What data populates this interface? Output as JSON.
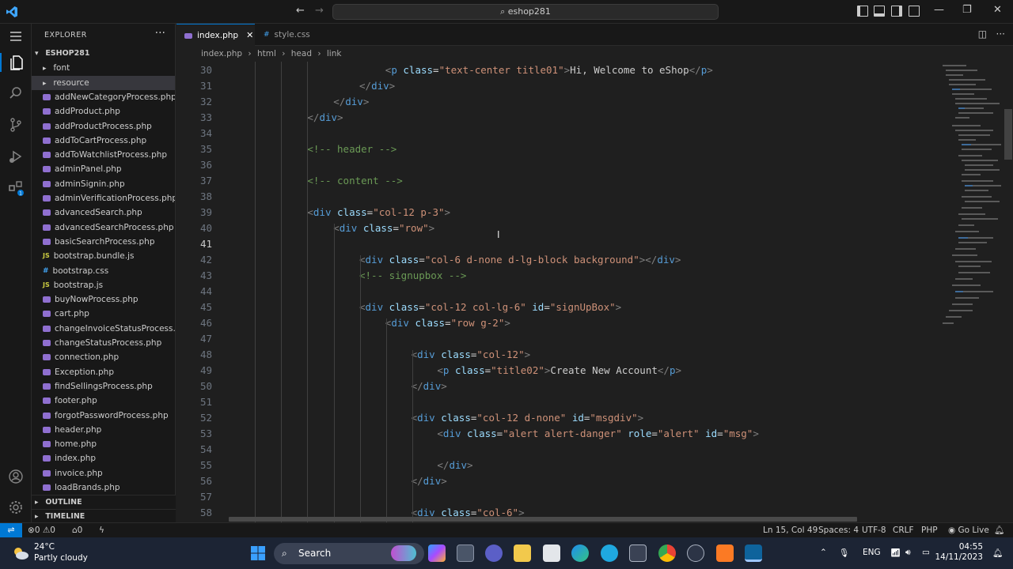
{
  "titlebar": {
    "search_text": "eshop281"
  },
  "explorer": {
    "title": "EXPLORER",
    "more": "···",
    "root": "ESHOP281",
    "folders": [
      "font",
      "resource"
    ],
    "files": [
      {
        "name": "addNewCategoryProcess.php",
        "type": "php"
      },
      {
        "name": "addProduct.php",
        "type": "php"
      },
      {
        "name": "addProductProcess.php",
        "type": "php"
      },
      {
        "name": "addToCartProcess.php",
        "type": "php"
      },
      {
        "name": "addToWatchlistProcess.php",
        "type": "php"
      },
      {
        "name": "adminPanel.php",
        "type": "php"
      },
      {
        "name": "adminSignin.php",
        "type": "php"
      },
      {
        "name": "adminVerificationProcess.php",
        "type": "php"
      },
      {
        "name": "advancedSearch.php",
        "type": "php"
      },
      {
        "name": "advancedSearchProcess.php",
        "type": "php"
      },
      {
        "name": "basicSearchProcess.php",
        "type": "php"
      },
      {
        "name": "bootstrap.bundle.js",
        "type": "js"
      },
      {
        "name": "bootstrap.css",
        "type": "css"
      },
      {
        "name": "bootstrap.js",
        "type": "js"
      },
      {
        "name": "buyNowProcess.php",
        "type": "php"
      },
      {
        "name": "cart.php",
        "type": "php"
      },
      {
        "name": "changeInvoiceStatusProcess.p...",
        "type": "php"
      },
      {
        "name": "changeStatusProcess.php",
        "type": "php"
      },
      {
        "name": "connection.php",
        "type": "php"
      },
      {
        "name": "Exception.php",
        "type": "php"
      },
      {
        "name": "findSellingsProcess.php",
        "type": "php"
      },
      {
        "name": "footer.php",
        "type": "php"
      },
      {
        "name": "forgotPasswordProcess.php",
        "type": "php"
      },
      {
        "name": "header.php",
        "type": "php"
      },
      {
        "name": "home.php",
        "type": "php"
      },
      {
        "name": "index.php",
        "type": "php"
      },
      {
        "name": "invoice.php",
        "type": "php"
      },
      {
        "name": "loadBrands.php",
        "type": "php"
      }
    ],
    "outline": "OUTLINE",
    "timeline": "TIMELINE"
  },
  "tabs": [
    {
      "label": "index.php",
      "active": true
    },
    {
      "label": "style.css",
      "active": false
    }
  ],
  "breadcrumb": [
    "index.php",
    "html",
    "head",
    "link"
  ],
  "editor": {
    "current_line": 41,
    "lines": [
      {
        "n": "30",
        "indent": 6,
        "html": "<span class='p'>&lt;</span><span class='t'>p</span> <span class='a'>class</span><span class='x'>=</span><span class='s'>\"text-center title01\"</span><span class='p'>&gt;</span>Hi, Welcome to eShop<span class='p'>&lt;/</span><span class='t'>p</span><span class='p'>&gt;</span>"
      },
      {
        "n": "31",
        "indent": 5,
        "html": "<span class='p'>&lt;/</span><span class='t'>div</span><span class='p'>&gt;</span>"
      },
      {
        "n": "32",
        "indent": 4,
        "html": "<span class='p'>&lt;/</span><span class='t'>div</span><span class='p'>&gt;</span>"
      },
      {
        "n": "33",
        "indent": 3,
        "html": "<span class='p'>&lt;/</span><span class='t'>div</span><span class='p'>&gt;</span>"
      },
      {
        "n": "34",
        "indent": 0,
        "html": ""
      },
      {
        "n": "35",
        "indent": 3,
        "html": "<span class='c'>&lt;!-- header --&gt;</span>"
      },
      {
        "n": "36",
        "indent": 0,
        "html": ""
      },
      {
        "n": "37",
        "indent": 3,
        "html": "<span class='c'>&lt;!-- content --&gt;</span>"
      },
      {
        "n": "38",
        "indent": 0,
        "html": ""
      },
      {
        "n": "39",
        "indent": 3,
        "html": "<span class='p'>&lt;</span><span class='t'>div</span> <span class='a'>class</span><span class='x'>=</span><span class='s'>\"col-12 p-3\"</span><span class='p'>&gt;</span>"
      },
      {
        "n": "40",
        "indent": 4,
        "html": "<span class='p'>&lt;</span><span class='t'>div</span> <span class='a'>class</span><span class='x'>=</span><span class='s'>\"row\"</span><span class='p'>&gt;</span>"
      },
      {
        "n": "41",
        "indent": 0,
        "html": ""
      },
      {
        "n": "42",
        "indent": 5,
        "html": "<span class='p'>&lt;</span><span class='t'>div</span> <span class='a'>class</span><span class='x'>=</span><span class='s'>\"col-6 d-none d-lg-block background\"</span><span class='p'>&gt;&lt;/</span><span class='t'>div</span><span class='p'>&gt;</span>"
      },
      {
        "n": "43",
        "indent": 5,
        "html": "<span class='c'>&lt;!-- signupbox --&gt;</span>"
      },
      {
        "n": "44",
        "indent": 0,
        "html": ""
      },
      {
        "n": "45",
        "indent": 5,
        "html": "<span class='p'>&lt;</span><span class='t'>div</span> <span class='a'>class</span><span class='x'>=</span><span class='s'>\"col-12 col-lg-6\"</span> <span class='a'>id</span><span class='x'>=</span><span class='s'>\"signUpBox\"</span><span class='p'>&gt;</span>"
      },
      {
        "n": "46",
        "indent": 6,
        "html": "<span class='p'>&lt;</span><span class='t'>div</span> <span class='a'>class</span><span class='x'>=</span><span class='s'>\"row g-2\"</span><span class='p'>&gt;</span>"
      },
      {
        "n": "47",
        "indent": 0,
        "html": ""
      },
      {
        "n": "48",
        "indent": 7,
        "html": "<span class='p'>&lt;</span><span class='t'>div</span> <span class='a'>class</span><span class='x'>=</span><span class='s'>\"col-12\"</span><span class='p'>&gt;</span>"
      },
      {
        "n": "49",
        "indent": 8,
        "html": "<span class='p'>&lt;</span><span class='t'>p</span> <span class='a'>class</span><span class='x'>=</span><span class='s'>\"title02\"</span><span class='p'>&gt;</span>Create New Account<span class='p'>&lt;/</span><span class='t'>p</span><span class='p'>&gt;</span>"
      },
      {
        "n": "50",
        "indent": 7,
        "html": "<span class='p'>&lt;/</span><span class='t'>div</span><span class='p'>&gt;</span>"
      },
      {
        "n": "51",
        "indent": 0,
        "html": ""
      },
      {
        "n": "52",
        "indent": 7,
        "html": "<span class='p'>&lt;</span><span class='t'>div</span> <span class='a'>class</span><span class='x'>=</span><span class='s'>\"col-12 d-none\"</span> <span class='a'>id</span><span class='x'>=</span><span class='s'>\"msgdiv\"</span><span class='p'>&gt;</span>"
      },
      {
        "n": "53",
        "indent": 8,
        "html": "<span class='p'>&lt;</span><span class='t'>div</span> <span class='a'>class</span><span class='x'>=</span><span class='s'>\"alert alert-danger\"</span> <span class='a'>role</span><span class='x'>=</span><span class='s'>\"alert\"</span> <span class='a'>id</span><span class='x'>=</span><span class='s'>\"msg\"</span><span class='p'>&gt;</span>"
      },
      {
        "n": "54",
        "indent": 0,
        "html": ""
      },
      {
        "n": "55",
        "indent": 8,
        "html": "<span class='p'>&lt;/</span><span class='t'>div</span><span class='p'>&gt;</span>"
      },
      {
        "n": "56",
        "indent": 7,
        "html": "<span class='p'>&lt;/</span><span class='t'>div</span><span class='p'>&gt;</span>"
      },
      {
        "n": "57",
        "indent": 0,
        "html": ""
      },
      {
        "n": "58",
        "indent": 7,
        "html": "<span class='p'>&lt;</span><span class='t'>div</span> <span class='a'>class</span><span class='x'>=</span><span class='s'>\"col-6\"</span><span class='p'>&gt;</span>"
      }
    ]
  },
  "statusbar": {
    "errors": "0",
    "warnings": "0",
    "ports": "0",
    "position": "Ln 15, Col 49",
    "spaces": "Spaces: 4",
    "encoding": "UTF-8",
    "eol": "CRLF",
    "language": "PHP",
    "golive": "Go Live"
  },
  "taskbar": {
    "temperature": "24°C",
    "weather": "Partly cloudy",
    "search": "Search",
    "language": "ENG",
    "time": "04:55",
    "date": "14/11/2023"
  },
  "colors": {
    "accent": "#0078d4",
    "editor_bg": "#1f1f1f",
    "sidebar_bg": "#181818",
    "tag": "#569cd6",
    "attribute": "#9cdcfe",
    "string": "#ce9178",
    "comment": "#6a9955"
  }
}
